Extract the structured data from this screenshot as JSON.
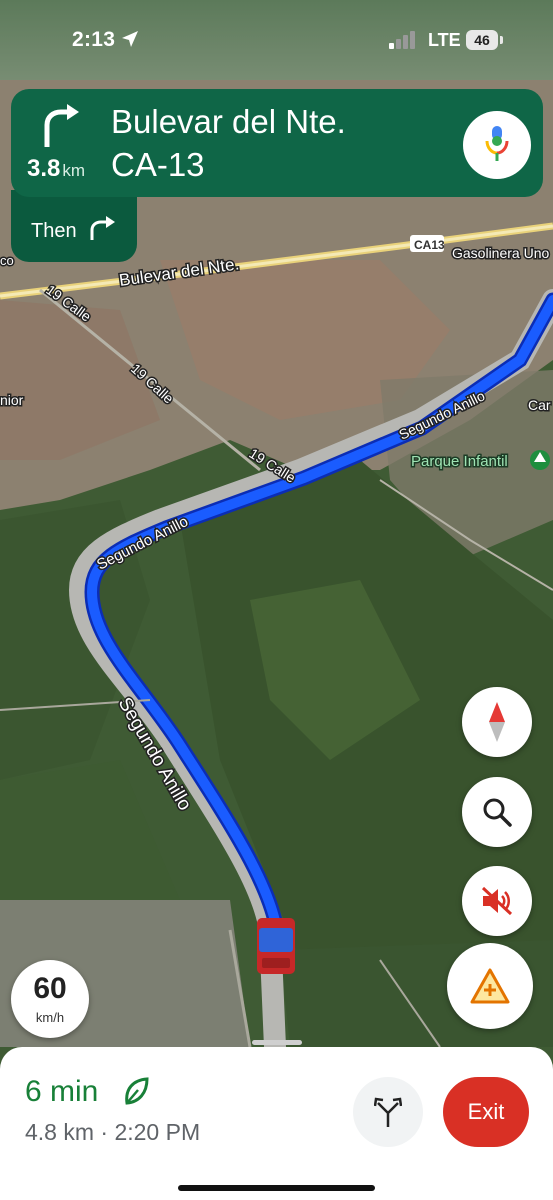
{
  "status_bar": {
    "time": "2:13",
    "network": "LTE",
    "battery": "46"
  },
  "navigation": {
    "distance": "3.8",
    "distance_unit": "km",
    "road_primary": "Bulevar del Nte.",
    "road_secondary": "CA-13",
    "then_label": "Then",
    "banner_color": "#0f6647"
  },
  "map": {
    "labels": {
      "bulevar": "Bulevar del Nte.",
      "ca13": "CA13",
      "gasolinera": "Gasolinera Uno",
      "calle19_a": "19 Calle",
      "calle19_b": "19 Calle",
      "calle19_c": "19 Calle",
      "segundo_anillo_a": "Segundo Anillo",
      "segundo_anillo_b": "Segundo Anillo",
      "segundo_anillo_c": "Segundo Anillo",
      "parque": "Parque Infantil",
      "junior": "nior",
      "co": "co",
      "car": "Car"
    },
    "route_color": "#1a5cff"
  },
  "speed_limit": {
    "value": "60",
    "unit": "km/h"
  },
  "controls": {
    "compass": "compass-icon",
    "search": "search-icon",
    "mute": "volume-off-icon",
    "report": "report-incident-icon"
  },
  "trip": {
    "eta_minutes": "6 min",
    "distance_time": "4.8 km · 2:20 PM",
    "exit_label": "Exit",
    "eta_color": "#188038",
    "exit_color": "#d93025"
  }
}
